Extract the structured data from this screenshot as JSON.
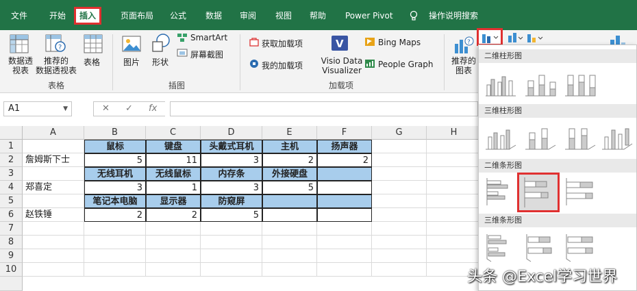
{
  "menu": {
    "tabs": [
      "文件",
      "开始",
      "插入",
      "页面布局",
      "公式",
      "数据",
      "审阅",
      "视图",
      "帮助",
      "Power Pivot",
      "操作说明搜索"
    ],
    "active_tab": "插入"
  },
  "ribbon": {
    "pivot": "数据透\n视表",
    "recommended_pivot": "推荐的\n数据透视表",
    "table": "表格",
    "group_tables": "表格",
    "pictures": "图片",
    "shapes": "形状",
    "smartart": "SmartArt",
    "screenshot": "屏幕截图",
    "group_illustrations": "插图",
    "get_addins": "获取加载项",
    "my_addins": "我的加载项",
    "visio": "Visio Data\nVisualizer",
    "bing_maps": "Bing Maps",
    "people_graph": "People Graph",
    "group_addins": "加载项",
    "recommended_charts": "推荐的\n图表"
  },
  "formula_bar": {
    "name_box": "A1",
    "fx": "fx",
    "cancel": "✕",
    "enter": "✓",
    "value": ""
  },
  "columns": [
    "A",
    "B",
    "C",
    "D",
    "E",
    "F",
    "G",
    "H"
  ],
  "rows": [
    "1",
    "2",
    "3",
    "4",
    "5",
    "6",
    "7",
    "8",
    "9",
    "10"
  ],
  "sheet": {
    "r1": [
      "",
      "鼠标",
      "键盘",
      "头戴式耳机",
      "主机",
      "扬声器"
    ],
    "r2": [
      "詹姆斯下士",
      "5",
      "11",
      "3",
      "2",
      "2"
    ],
    "r3": [
      "",
      "无线耳机",
      "无线鼠标",
      "内存条",
      "外接硬盘",
      ""
    ],
    "r4": [
      "郑喜定",
      "3",
      "1",
      "3",
      "5",
      ""
    ],
    "r5": [
      "",
      "笔记本电脑",
      "显示器",
      "防窥屏",
      "",
      ""
    ],
    "r6": [
      "赵铁锤",
      "2",
      "2",
      "5",
      "",
      ""
    ]
  },
  "dropdown": {
    "sections": [
      "二维柱形图",
      "三维柱形图",
      "二维条形图",
      "三维条形图"
    ]
  },
  "watermark": "头条 @Excel学习世界",
  "colors": {
    "excel_green": "#217346",
    "header_fill": "#a8cdec",
    "highlight_red": "#e03030"
  }
}
